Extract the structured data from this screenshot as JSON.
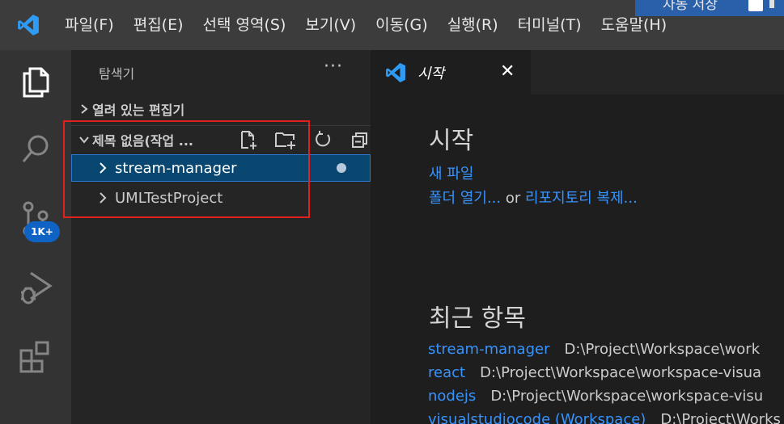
{
  "menu": {
    "items": [
      "파일(F)",
      "편집(E)",
      "선택 영역(S)",
      "보기(V)",
      "이동(G)",
      "실행(R)",
      "터미널(T)",
      "도움말(H)"
    ]
  },
  "other_window": {
    "text": "자동 저장"
  },
  "activity_bar": {
    "items": [
      "explorer-icon",
      "search-icon",
      "source-control-icon",
      "run-debug-icon",
      "extensions-icon"
    ],
    "source_control_badge": "1K+"
  },
  "sidebar": {
    "title": "탐색기",
    "more": "···",
    "open_editors_label": "열려 있는 편집기",
    "workspace_label": "제목 없음(작업 ...",
    "workspace_actions": [
      "new-file-icon",
      "new-folder-icon",
      "refresh-icon",
      "collapse-all-icon"
    ],
    "folders": [
      {
        "label": "stream-manager",
        "selected": true,
        "modified": true
      },
      {
        "label": "UMLTestProject",
        "selected": false,
        "modified": false
      }
    ]
  },
  "editor": {
    "tab_label": "시작",
    "close_symbol": "✕",
    "start_heading": "시작",
    "new_file_link": "새 파일",
    "open_folder_link": "폴더 열기...",
    "or_text": "or",
    "clone_repo_link": "리포지토리 복제...",
    "recent_heading": "최근 항목",
    "recent": [
      {
        "name": "stream-manager",
        "path": "D:\\Project\\Workspace\\work"
      },
      {
        "name": "react",
        "path": "D:\\Project\\Workspace\\workspace-visua"
      },
      {
        "name": "nodejs",
        "path": "D:\\Project\\Workspace\\workspace-visu"
      },
      {
        "name": "visualstudiocode (Workspace)",
        "path": "D:\\Project\\Works"
      }
    ]
  },
  "colors": {
    "titlebar": "#3c3c3c",
    "activity_bar": "#333333",
    "sidebar": "#252526",
    "editor": "#1e1e1e",
    "link": "#3794ff",
    "selection": "#094771",
    "badge": "#0e63c5",
    "annotation_box": "#e0211e"
  }
}
